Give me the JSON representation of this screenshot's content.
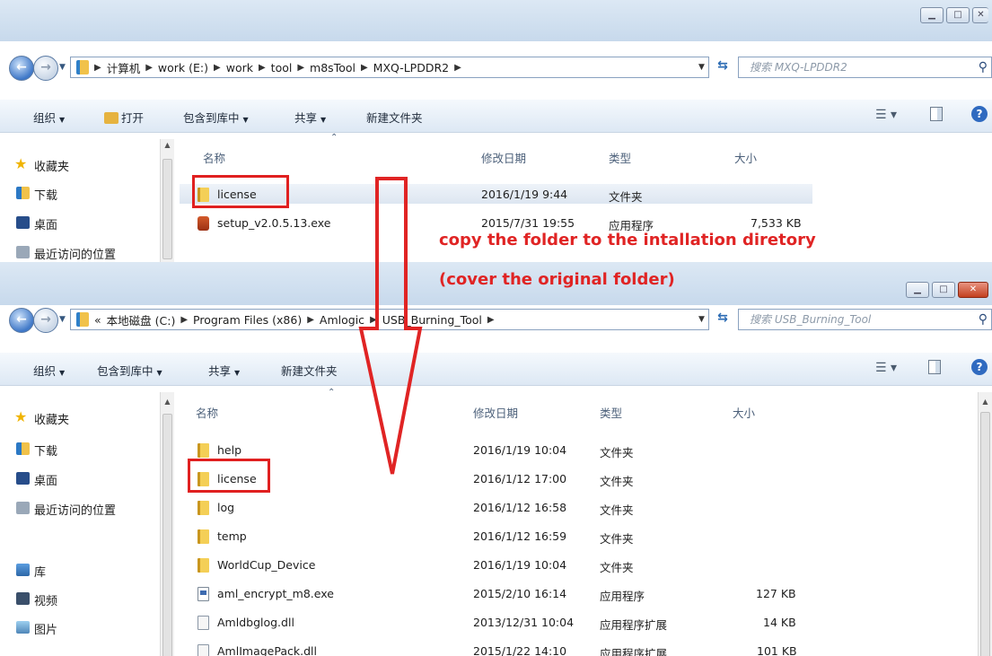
{
  "top": {
    "address": {
      "crumbs": [
        "计算机",
        "work (E:)",
        "work",
        "tool",
        "m8sTool",
        "MXQ-LPDDR2"
      ],
      "search_placeholder": "搜索 MXQ-LPDDR2"
    },
    "toolbar": {
      "organize": "组织",
      "open": "打开",
      "include_library": "包含到库中",
      "share": "共享",
      "new_folder": "新建文件夹"
    },
    "nav": [
      {
        "label": "收藏夹",
        "icon": "star-icon"
      },
      {
        "label": "下载",
        "icon": "download-folder-icon"
      },
      {
        "label": "桌面",
        "icon": "desktop-icon"
      },
      {
        "label": "最近访问的位置",
        "icon": "recent-places-icon"
      }
    ],
    "columns": {
      "name": "名称",
      "modified": "修改日期",
      "type": "类型",
      "size": "大小"
    },
    "files": [
      {
        "name": "license",
        "modified": "2016/1/19 9:44",
        "type": "文件夹",
        "size": "",
        "icon": "folder-icon",
        "selected": true
      },
      {
        "name": "setup_v2.0.5.13.exe",
        "modified": "2015/7/31 19:55",
        "type": "应用程序",
        "size": "7,533 KB",
        "icon": "installer-icon",
        "selected": false
      }
    ]
  },
  "bottom": {
    "address": {
      "prefix": "«",
      "crumbs": [
        "本地磁盘 (C:)",
        "Program Files (x86)",
        "Amlogic",
        "USB_Burning_Tool"
      ],
      "search_placeholder": "搜索 USB_Burning_Tool"
    },
    "toolbar": {
      "organize": "组织",
      "include_library": "包含到库中",
      "share": "共享",
      "new_folder": "新建文件夹"
    },
    "nav": [
      {
        "label": "收藏夹",
        "icon": "star-icon"
      },
      {
        "label": "下载",
        "icon": "download-folder-icon"
      },
      {
        "label": "桌面",
        "icon": "desktop-icon"
      },
      {
        "label": "最近访问的位置",
        "icon": "recent-places-icon"
      },
      {
        "label": "库",
        "icon": "library-icon"
      },
      {
        "label": "视频",
        "icon": "video-library-icon"
      },
      {
        "label": "图片",
        "icon": "picture-library-icon"
      }
    ],
    "columns": {
      "name": "名称",
      "modified": "修改日期",
      "type": "类型",
      "size": "大小"
    },
    "files": [
      {
        "name": "help",
        "modified": "2016/1/19 10:04",
        "type": "文件夹",
        "size": "",
        "icon": "folder-icon"
      },
      {
        "name": "license",
        "modified": "2016/1/12 17:00",
        "type": "文件夹",
        "size": "",
        "icon": "folder-icon"
      },
      {
        "name": "log",
        "modified": "2016/1/12 16:58",
        "type": "文件夹",
        "size": "",
        "icon": "folder-icon"
      },
      {
        "name": "temp",
        "modified": "2016/1/12 16:59",
        "type": "文件夹",
        "size": "",
        "icon": "folder-icon"
      },
      {
        "name": "WorldCup_Device",
        "modified": "2016/1/19 10:04",
        "type": "文件夹",
        "size": "",
        "icon": "folder-icon"
      },
      {
        "name": "aml_encrypt_m8.exe",
        "modified": "2015/2/10 16:14",
        "type": "应用程序",
        "size": "127 KB",
        "icon": "exe-icon"
      },
      {
        "name": "Amldbglog.dll",
        "modified": "2013/12/31 10:04",
        "type": "应用程序扩展",
        "size": "14 KB",
        "icon": "dll-icon"
      },
      {
        "name": "AmlImagePack.dll",
        "modified": "2015/1/22 14:10",
        "type": "应用程序扩展",
        "size": "101 KB",
        "icon": "dll-icon"
      }
    ]
  },
  "annotation": {
    "line1": "copy the folder to the intallation diretory",
    "line2": "(cover the original folder)",
    "color": "#e02424"
  }
}
